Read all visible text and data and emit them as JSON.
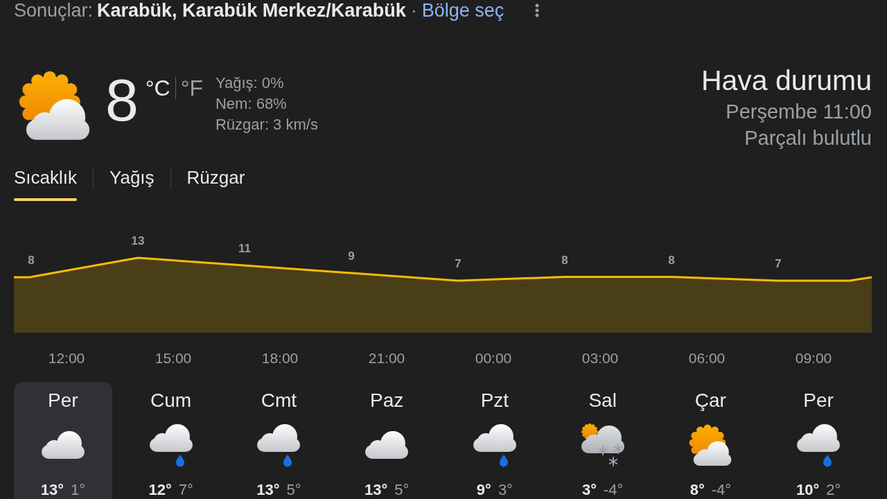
{
  "header": {
    "label": "Sonuçlar:",
    "location": "Karabük, Karabük Merkez/Karabük",
    "separator": "·",
    "link": "Bölge seç"
  },
  "current": {
    "kind": "partly_cloudy",
    "temperature": "8",
    "units": [
      {
        "label": "°C",
        "selected": true
      },
      {
        "label": "°F",
        "selected": false
      }
    ],
    "details": [
      "Yağış: 0%",
      "Nem: 68%",
      "Rüzgar: 3 km/s"
    ]
  },
  "summary": {
    "title": "Hava durumu",
    "time": "Perşembe 11:00",
    "condition": "Parçalı bulutlu"
  },
  "tabs": [
    {
      "label": "Sıcaklık",
      "selected": true
    },
    {
      "label": "Yağış",
      "selected": false
    },
    {
      "label": "Rüzgar",
      "selected": false
    }
  ],
  "temperature_chart": {
    "chart_data": {
      "type": "area",
      "categories": [
        null,
        null,
        null,
        null,
        null,
        null,
        null,
        null
      ],
      "series": [
        {
          "color": "#fbbc04",
          "values": [
            8,
            13,
            11,
            9,
            7,
            8,
            8,
            7
          ]
        }
      ],
      "data_labels": true
    },
    "time_labels": [
      "12:00",
      "15:00",
      "18:00",
      "21:00",
      "00:00",
      "03:00",
      "06:00",
      "09:00"
    ]
  },
  "days": [
    {
      "name": "Per",
      "kind": "cloudy",
      "high": "13°",
      "low": "1°",
      "selected": true
    },
    {
      "name": "Cum",
      "kind": "rain",
      "high": "12°",
      "low": "7°",
      "selected": false
    },
    {
      "name": "Cmt",
      "kind": "rain",
      "high": "13°",
      "low": "5°",
      "selected": false
    },
    {
      "name": "Paz",
      "kind": "cloudy",
      "high": "13°",
      "low": "5°",
      "selected": false
    },
    {
      "name": "Pzt",
      "kind": "rain",
      "high": "9°",
      "low": "3°",
      "selected": false
    },
    {
      "name": "Sal",
      "kind": "snow_sun",
      "high": "3°",
      "low": "-4°",
      "selected": false
    },
    {
      "name": "Çar",
      "kind": "partly_cloudy",
      "high": "8°",
      "low": "-4°",
      "selected": false
    },
    {
      "name": "Per",
      "kind": "rain",
      "high": "10°",
      "low": "2°",
      "selected": false
    }
  ]
}
